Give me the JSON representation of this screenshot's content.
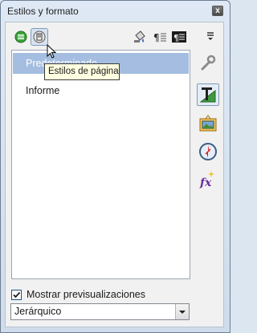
{
  "window": {
    "title": "Estilos y formato",
    "close_glyph": "x"
  },
  "toolbar": {
    "buttons": [
      {
        "icon": "paragraph-styles-icon"
      },
      {
        "icon": "page-styles-icon",
        "pressed": true
      },
      {
        "icon": "fill-format-icon"
      },
      {
        "icon": "new-style-from-selection-icon"
      },
      {
        "icon": "update-style-icon"
      }
    ],
    "menu_icon": "styles-actions-menu-icon"
  },
  "list": {
    "items": [
      {
        "label": "Predeterminado",
        "selected": true
      },
      {
        "label": "Informe",
        "selected": false
      }
    ]
  },
  "tooltip": {
    "text": "Estilos de página"
  },
  "sidebar": {
    "items": [
      {
        "icon": "properties-wrench-icon",
        "active": false
      },
      {
        "icon": "styles-and-formatting-icon",
        "active": true
      },
      {
        "icon": "gallery-icon",
        "active": false
      },
      {
        "icon": "navigator-compass-icon",
        "active": false
      },
      {
        "icon": "functions-fx-icon",
        "active": false
      }
    ]
  },
  "footer": {
    "show_previews_label": "Mostrar previsualizaciones",
    "show_previews_checked": true,
    "view_mode": "Jerárquico"
  }
}
